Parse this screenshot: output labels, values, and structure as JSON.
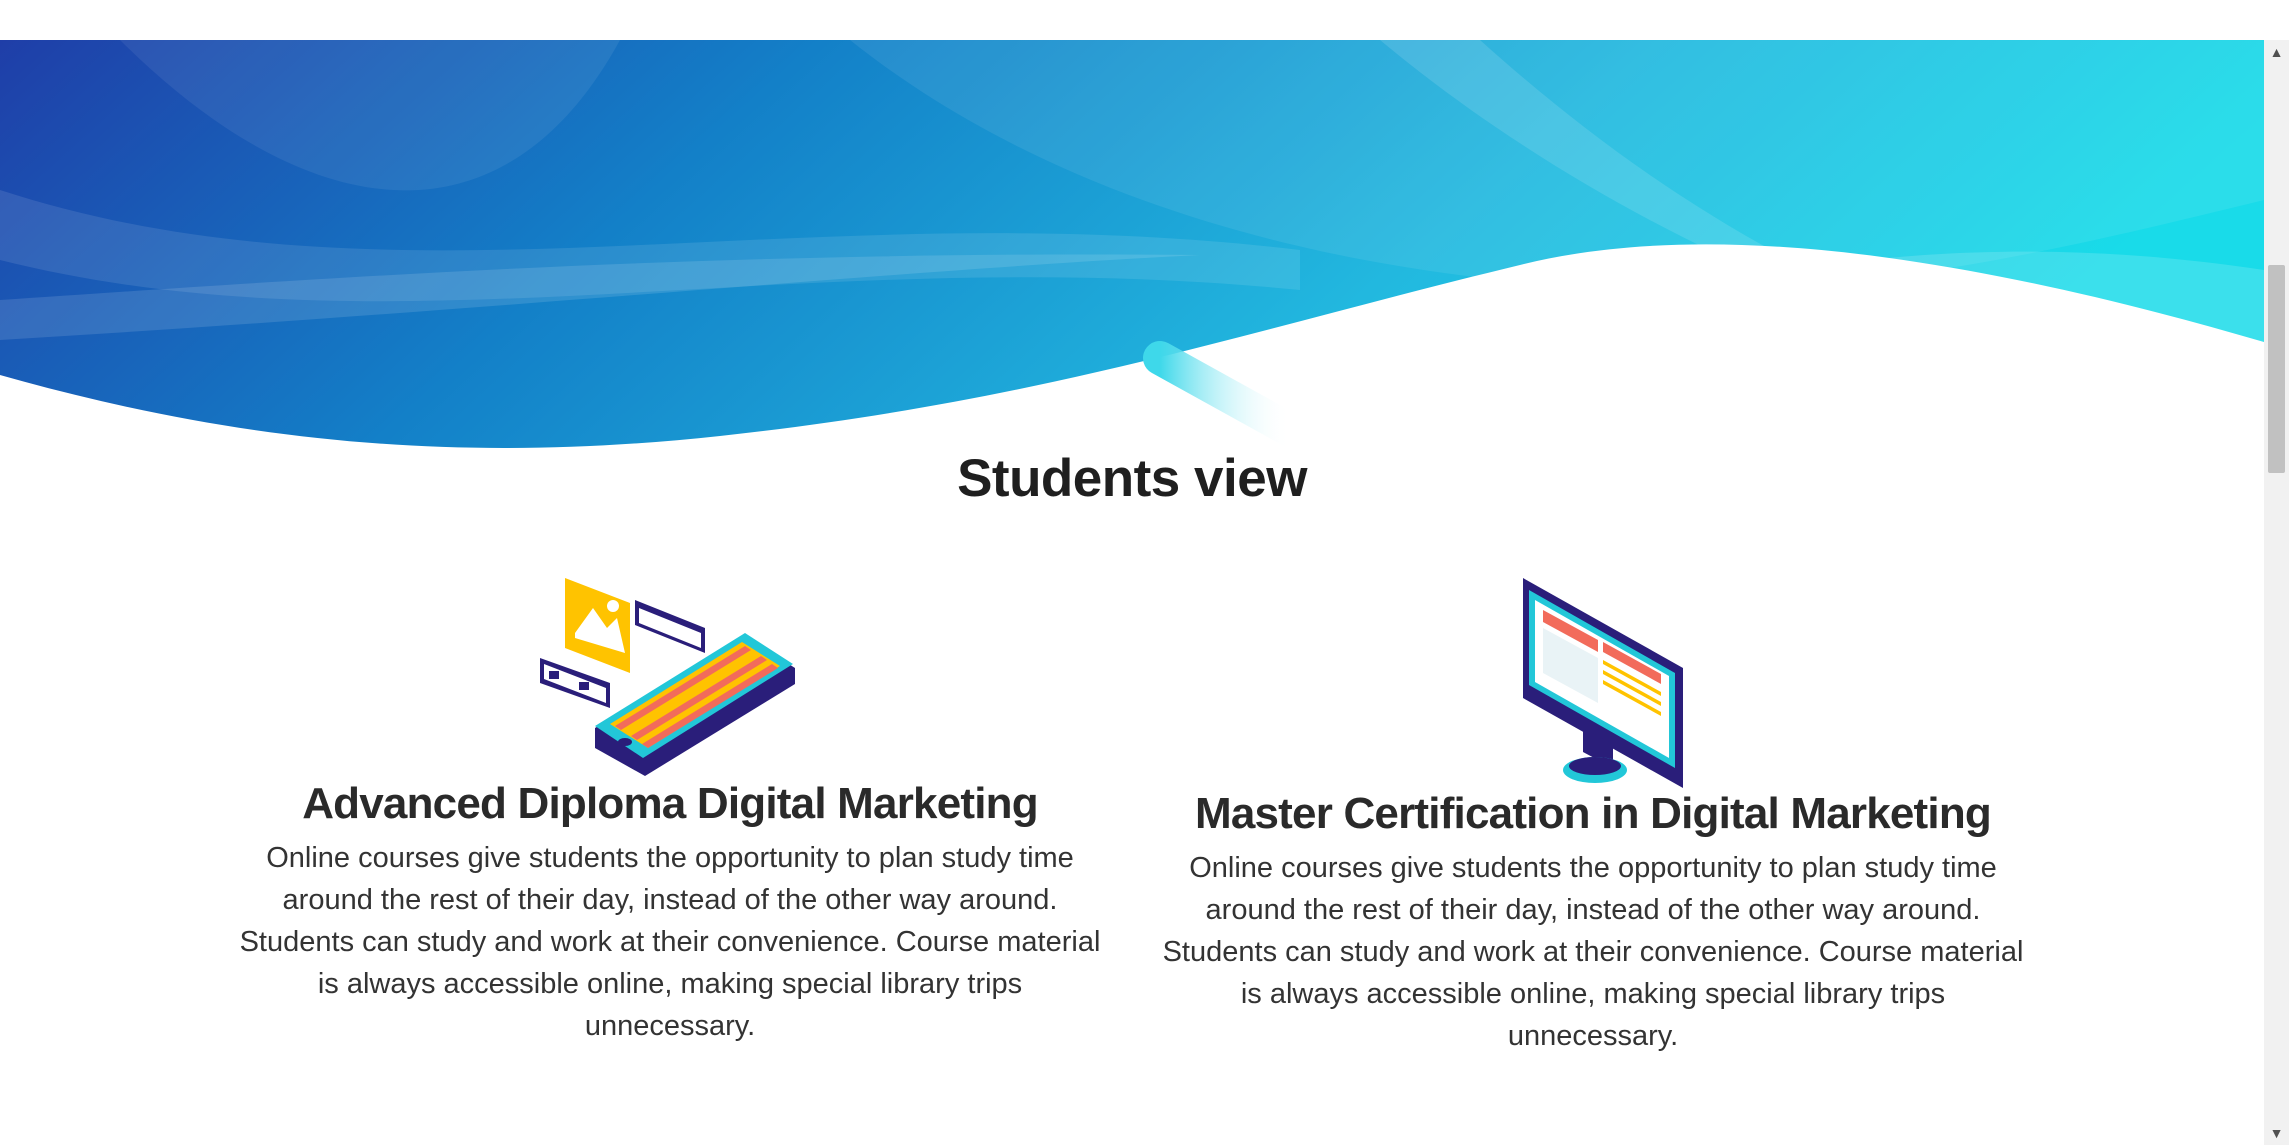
{
  "section": {
    "title": "Students view"
  },
  "cards": [
    {
      "icon": "smartphone-media-illustration",
      "title": "Advanced Diploma Digital Marketing",
      "description": "Online courses give students the opportunity to plan study time around the rest of their day, instead of the other way around. Students can study and work at their convenience. Course material is always accessible online, making special library trips unnecessary."
    },
    {
      "icon": "desktop-monitor-illustration",
      "title": "Master Certification in Digital Marketing",
      "description": "Online courses give students the opportunity to plan study time around the rest of their day, instead of the other way around. Students can study and work at their convenience. Course material is always accessible online, making special library trips unnecessary."
    }
  ],
  "scrollbar": {
    "up_icon": "scroll-up-arrow-icon",
    "down_icon": "scroll-down-arrow-icon"
  },
  "colors": {
    "hero_start": "#1e3fa6",
    "hero_end": "#18e0ec",
    "phone_body": "#22c7d8",
    "phone_screen": "#ffc300",
    "accent_red": "#f26b5b",
    "outline_navy": "#2a1e7a"
  }
}
